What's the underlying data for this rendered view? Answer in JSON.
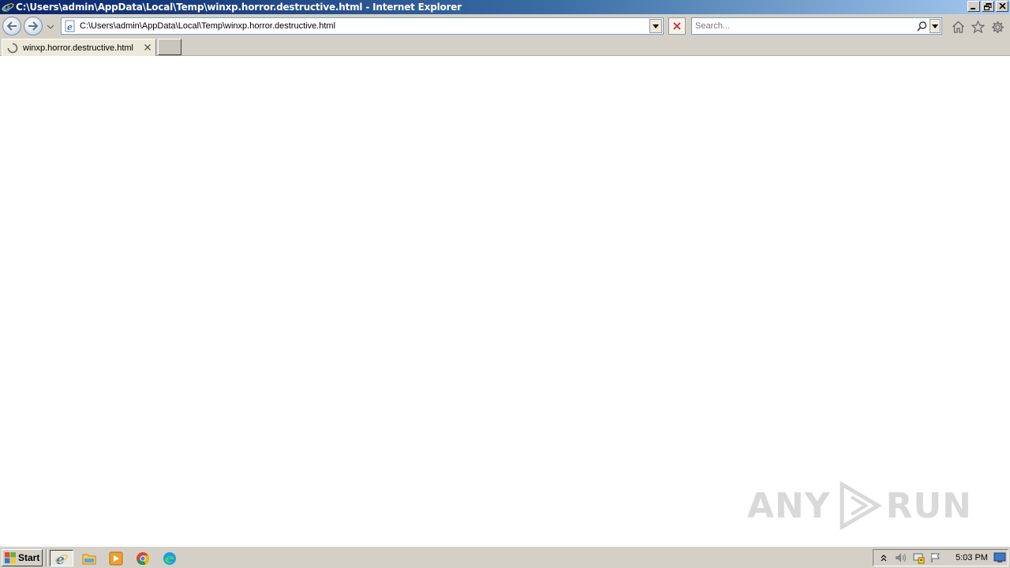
{
  "window": {
    "title": "C:\\Users\\admin\\AppData\\Local\\Temp\\winxp.horror.destructive.html - Internet Explorer"
  },
  "navbar": {
    "address": "C:\\Users\\admin\\AppData\\Local\\Temp\\winxp.horror.destructive.html",
    "search_placeholder": "Search..."
  },
  "tabs": [
    {
      "label": "winxp.horror.destructive.html",
      "loading": true
    }
  ],
  "watermark": {
    "left": "ANY",
    "right": "RUN"
  },
  "taskbar": {
    "start_label": "Start",
    "clock": "5:03 PM",
    "apps": [
      "internet-explorer",
      "file-explorer",
      "media-player",
      "chrome",
      "edge"
    ]
  },
  "colors": {
    "titlebar_start": "#0a246a",
    "titlebar_end": "#a6caf0",
    "chrome_gray": "#d4d0c8",
    "stop_red": "#d42020"
  }
}
